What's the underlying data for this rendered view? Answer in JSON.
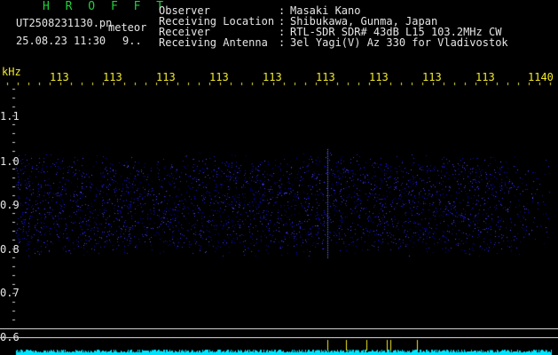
{
  "header": {
    "title": "H R O F F T",
    "filename": "UT2508231130.pn",
    "mode": "meteor",
    "datetime": "25.08.23 11:30",
    "count": "9.."
  },
  "info": {
    "labels": [
      "Observer",
      "Receiving Location",
      "Receiver",
      "Receiving Antenna"
    ],
    "colons": [
      ":",
      ":",
      ":",
      ":"
    ],
    "values": [
      "Masaki Kano",
      "Shibukawa, Gunma, Japan",
      "RTL-SDR SDR# 43dB L15 103.2MHz CW",
      "3el Yagi(V) Az 330 for Vladivostok"
    ]
  },
  "axis": {
    "unit": "kHz",
    "x_ticks": [
      "113",
      "113",
      "113",
      "113",
      "113",
      "113",
      "113",
      "113",
      "113",
      "1140"
    ],
    "y_ticks": [
      "1.1",
      "1.0",
      "0.9",
      "0.8",
      "0.7",
      "0.6"
    ]
  },
  "colors": {
    "background": "#000000",
    "signal": "#2a3cff",
    "axis_text": "#f2ea2a",
    "baseline": "#00e5ff"
  }
}
